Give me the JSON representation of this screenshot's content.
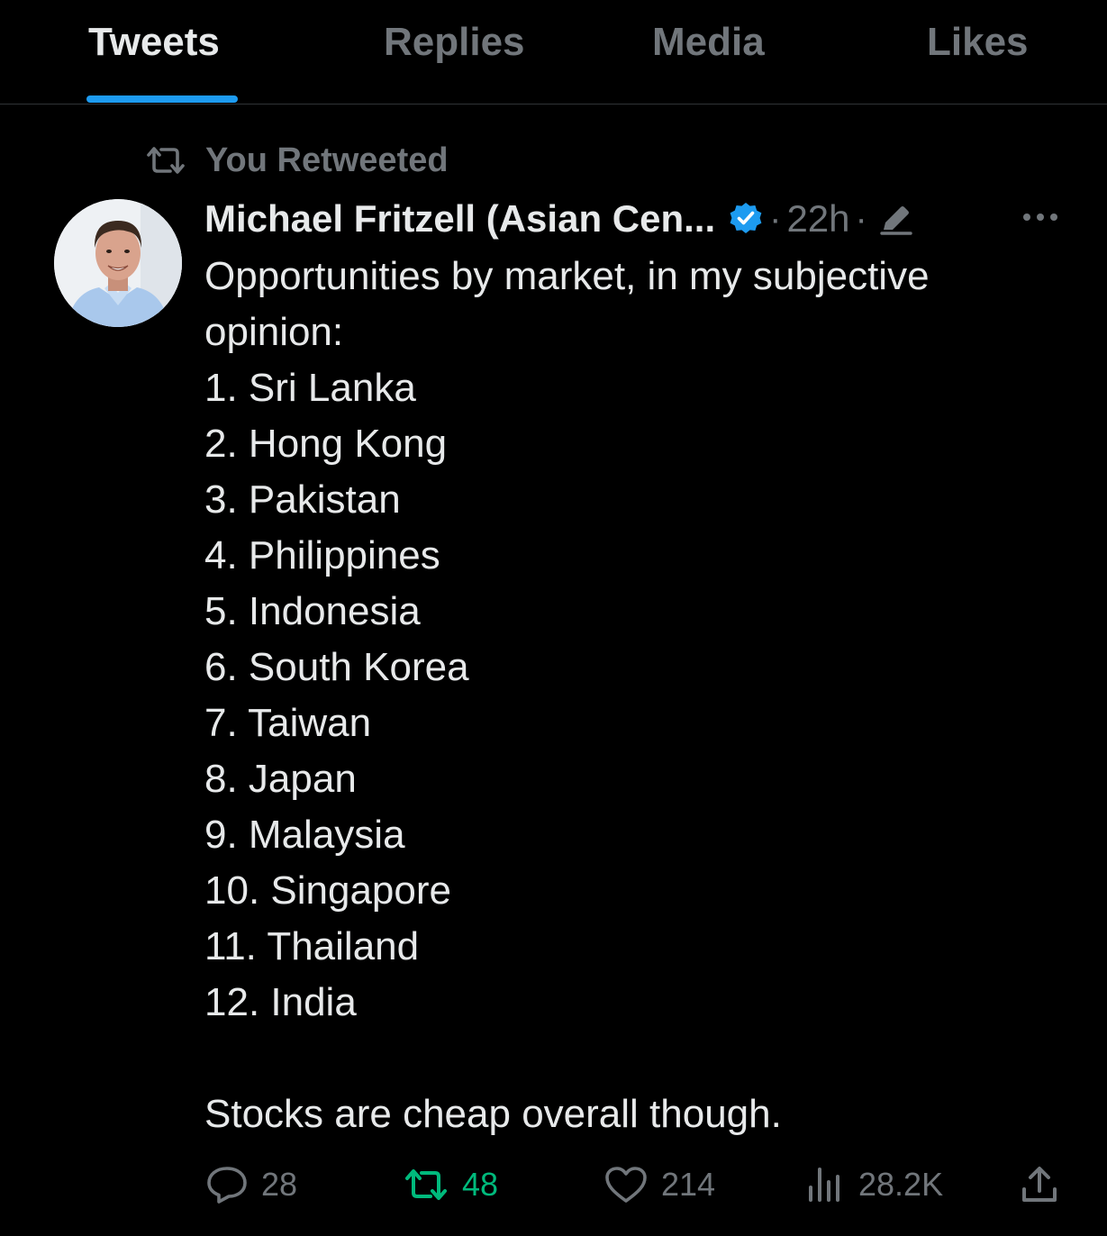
{
  "tabs": [
    {
      "label": "Tweets",
      "active": true
    },
    {
      "label": "Replies",
      "active": false
    },
    {
      "label": "Media",
      "active": false
    },
    {
      "label": "Likes",
      "active": false
    }
  ],
  "retweet_context": {
    "icon": "retweet-icon",
    "text": "You Retweeted"
  },
  "tweet": {
    "author_name": "Michael Fritzell (Asian Cen...",
    "verified_icon": "verified-badge-icon",
    "timestamp": "22h",
    "separator": "·",
    "edited_icon": "edit-icon",
    "more_icon": "more-icon",
    "body": {
      "intro": "Opportunities by market, in my subjective opinion:",
      "list": [
        "1. Sri Lanka",
        "2. Hong Kong",
        "3. Pakistan",
        "4. Philippines",
        "5. Indonesia",
        "6. South Korea",
        "7. Taiwan",
        "8. Japan",
        "9. Malaysia",
        "10. Singapore",
        "11. Thailand",
        "12. India"
      ],
      "closing": "Stocks are cheap overall though."
    },
    "actions": {
      "replies": "28",
      "retweets": "48",
      "likes": "214",
      "views": "28.2K"
    }
  },
  "colors": {
    "background": "#000000",
    "text_primary": "#e7e9ea",
    "text_secondary": "#71767b",
    "accent": "#1d9bf0",
    "retweet_active": "#00ba7c",
    "divider": "#2f3336"
  }
}
